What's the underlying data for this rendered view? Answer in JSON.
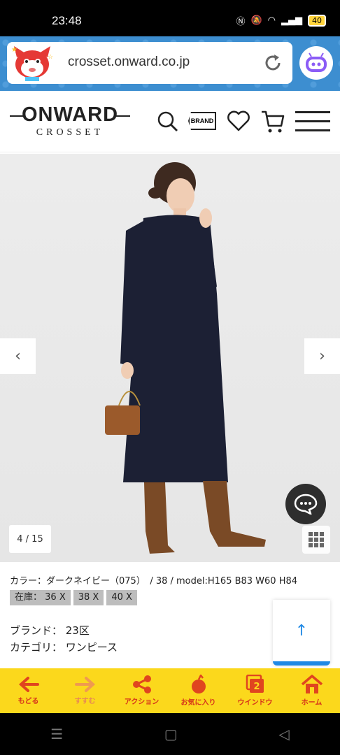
{
  "status": {
    "time": "23:48",
    "battery": "40"
  },
  "browser": {
    "url": "crosset.onward.co.jp"
  },
  "site": {
    "logo_main": "ONWARD",
    "logo_sub": "CROSSET",
    "brand_label": "BRAND"
  },
  "gallery": {
    "counter": "4 / 15",
    "prev": "‹",
    "next": "›"
  },
  "product": {
    "color_line": "カラー：ダークネイビー（075）　/  38  /  model:H165 B83 W60 H84",
    "stock_label": "在庫：",
    "sizes": [
      "36",
      "38",
      "40"
    ],
    "brand_line": "ブランド： 23区",
    "category_line": "カテゴリ： ワンピース"
  },
  "toolbar": {
    "items": [
      {
        "label": "もどる",
        "icon": "back-arrow-icon"
      },
      {
        "label": "すすむ",
        "icon": "forward-arrow-icon"
      },
      {
        "label": "アクション",
        "icon": "share-icon"
      },
      {
        "label": "お気に入り",
        "icon": "favorite-icon"
      },
      {
        "label": "ウインドウ",
        "icon": "window-icon",
        "badge": "2"
      },
      {
        "label": "ホーム",
        "icon": "home-icon"
      }
    ]
  },
  "colors": {
    "toolbar_bg": "#fbd81c",
    "toolbar_text": "#d6321b",
    "browser_bar": "#3d8ed0",
    "accent": "#1e88e5"
  }
}
